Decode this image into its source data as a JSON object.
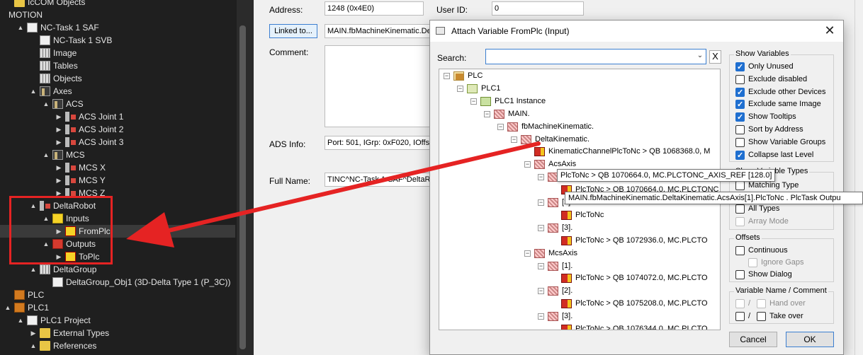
{
  "tree": {
    "items": [
      {
        "label": "IcCOM Objects",
        "indent": 0,
        "icon": "folder",
        "expander": ""
      },
      {
        "label": "MOTION",
        "indent": 0,
        "icon": "none",
        "expander": ""
      },
      {
        "label": "NC-Task 1 SAF",
        "indent": 1,
        "icon": "page",
        "expander": "▲"
      },
      {
        "label": "NC-Task 1 SVB",
        "indent": 2,
        "icon": "page",
        "expander": ""
      },
      {
        "label": "Image",
        "indent": 2,
        "icon": "grid",
        "expander": ""
      },
      {
        "label": "Tables",
        "indent": 2,
        "icon": "grid",
        "expander": ""
      },
      {
        "label": "Objects",
        "indent": 2,
        "icon": "grid",
        "expander": ""
      },
      {
        "label": "Axes",
        "indent": 2,
        "icon": "axis",
        "expander": "▲"
      },
      {
        "label": "ACS",
        "indent": 3,
        "icon": "axis",
        "expander": "▲"
      },
      {
        "label": "ACS Joint 1",
        "indent": 4,
        "icon": "joint",
        "expander": "▶"
      },
      {
        "label": "ACS Joint 2",
        "indent": 4,
        "icon": "joint",
        "expander": "▶"
      },
      {
        "label": "ACS Joint 3",
        "indent": 4,
        "icon": "joint",
        "expander": "▶"
      },
      {
        "label": "MCS",
        "indent": 3,
        "icon": "axis",
        "expander": "▲"
      },
      {
        "label": "MCS X",
        "indent": 4,
        "icon": "joint",
        "expander": "▶"
      },
      {
        "label": "MCS Y",
        "indent": 4,
        "icon": "joint",
        "expander": "▶"
      },
      {
        "label": "MCS Z",
        "indent": 4,
        "icon": "joint",
        "expander": "▶"
      },
      {
        "label": "DeltaRobot",
        "indent": 2,
        "icon": "joint",
        "expander": "▲"
      },
      {
        "label": "Inputs",
        "indent": 3,
        "icon": "yellow",
        "expander": "▲"
      },
      {
        "label": "FromPlc",
        "indent": 4,
        "icon": "var",
        "expander": "▶",
        "selected": true
      },
      {
        "label": "Outputs",
        "indent": 3,
        "icon": "red",
        "expander": "▲"
      },
      {
        "label": "ToPlc",
        "indent": 4,
        "icon": "var",
        "expander": "▶"
      },
      {
        "label": "DeltaGroup",
        "indent": 2,
        "icon": "grid",
        "expander": "▲"
      },
      {
        "label": "DeltaGroup_Obj1 (3D-Delta Type 1 (P_3C))",
        "indent": 3,
        "icon": "page",
        "expander": ""
      },
      {
        "label": "PLC",
        "indent": 0,
        "icon": "plc",
        "expander": ""
      },
      {
        "label": "PLC1",
        "indent": 0,
        "icon": "plc",
        "expander": "▲"
      },
      {
        "label": "PLC1 Project",
        "indent": 1,
        "icon": "page",
        "expander": "▲"
      },
      {
        "label": "External Types",
        "indent": 2,
        "icon": "folder",
        "expander": "▶"
      },
      {
        "label": "References",
        "indent": 2,
        "icon": "folder",
        "expander": "▲"
      }
    ]
  },
  "form": {
    "address_label": "Address:",
    "address_value": "1248 (0x4E0)",
    "userid_label": "User ID:",
    "userid_value": "0",
    "linked_button": "Linked to...",
    "linked_value": "MAIN.fbMachineKinematic.De",
    "comment_label": "Comment:",
    "ads_label": "ADS Info:",
    "ads_value": "Port: 501, IGrp: 0xF020, IOffs:",
    "fullname_label": "Full Name:",
    "fullname_value": "TINC^NC-Task 1 SAF^DeltaR"
  },
  "dialog": {
    "title": "Attach Variable FromPlc (Input)",
    "close": "✕",
    "search_label": "Search:",
    "search_value": "",
    "search_clear": "X",
    "var_tree": [
      {
        "label": "PLC",
        "indent": 0,
        "icon": "plc",
        "exp": "−"
      },
      {
        "label": "PLC1",
        "indent": 1,
        "icon": "plc1",
        "exp": "−"
      },
      {
        "label": "PLC1 Instance",
        "indent": 2,
        "icon": "inst",
        "exp": "−"
      },
      {
        "label": "MAIN.",
        "indent": 3,
        "icon": "struct",
        "exp": "−"
      },
      {
        "label": "fbMachineKinematic.",
        "indent": 4,
        "icon": "struct",
        "exp": "−"
      },
      {
        "label": "DeltaKinematic.",
        "indent": 5,
        "icon": "struct",
        "exp": "−"
      },
      {
        "label": "KinematicChannelPlcToNc   >   QB 1068368.0, M",
        "indent": 6,
        "icon": "varin",
        "exp": ""
      },
      {
        "label": "AcsAxis",
        "indent": 6,
        "icon": "struct",
        "exp": "−"
      },
      {
        "label": "[1].",
        "indent": 7,
        "icon": "struct",
        "exp": "−"
      },
      {
        "label": "PlcToNc   >   QB 1070664.0, MC.PLCTONC_AXIS_REF [128.0]",
        "indent": 8,
        "icon": "varin",
        "exp": ""
      },
      {
        "label": "[2].",
        "indent": 7,
        "icon": "struct",
        "exp": "−"
      },
      {
        "label": "PlcToNc",
        "indent": 8,
        "icon": "varin",
        "exp": ""
      },
      {
        "label": "[3].",
        "indent": 7,
        "icon": "struct",
        "exp": "−"
      },
      {
        "label": "PlcToNc   >   QB 1072936.0, MC.PLCTO",
        "indent": 8,
        "icon": "varin",
        "exp": ""
      },
      {
        "label": "McsAxis",
        "indent": 6,
        "icon": "struct",
        "exp": "−"
      },
      {
        "label": "[1].",
        "indent": 7,
        "icon": "struct",
        "exp": "−"
      },
      {
        "label": "PlcToNc   >   QB 1074072.0, MC.PLCTO",
        "indent": 8,
        "icon": "varin",
        "exp": ""
      },
      {
        "label": "[2].",
        "indent": 7,
        "icon": "struct",
        "exp": "−"
      },
      {
        "label": "PlcToNc   >   QB 1075208.0, MC.PLCTO",
        "indent": 8,
        "icon": "varin",
        "exp": ""
      },
      {
        "label": "[3].",
        "indent": 7,
        "icon": "struct",
        "exp": "−"
      },
      {
        "label": "PlcToNc   >   QB 1076344.0, MC.PLCTO",
        "indent": 8,
        "icon": "varin",
        "exp": ""
      }
    ],
    "tooltip_short": "PlcToNc   >   QB 1070664.0, MC.PLCTONC_AXIS_REF [128.0]",
    "tooltip_long": "MAIN.fbMachineKinematic.DeltaKinematic.AcsAxis[1].PlcToNc . PlcTask Outpu",
    "show_variables": {
      "title": "Show Variables",
      "options": [
        {
          "label": "Only Unused",
          "checked": true
        },
        {
          "label": "Exclude disabled",
          "checked": false
        },
        {
          "label": "Exclude other Devices",
          "checked": true
        },
        {
          "label": "Exclude same Image",
          "checked": true
        },
        {
          "label": "Show Tooltips",
          "checked": true
        },
        {
          "label": "Sort by Address",
          "checked": false
        },
        {
          "label": "Show Variable Groups",
          "checked": false
        },
        {
          "label": "Collapse last Level",
          "checked": true
        }
      ]
    },
    "show_variable_types": {
      "title": "Show Variable Types",
      "matching_type": "Matching Type",
      "all_types": "All Types",
      "array_mode": "Array Mode"
    },
    "offsets": {
      "title": "Offsets",
      "continuous": "Continuous",
      "ignore_gaps": "Ignore Gaps",
      "show_dialog": "Show Dialog"
    },
    "varname": {
      "title": "Variable Name / Comment",
      "hand_over": "Hand over",
      "take_over": "Take over",
      "sep": "/"
    },
    "cancel": "Cancel",
    "ok": "OK"
  },
  "colors": {
    "annotation_red": "#e52323",
    "accent": "#1f6fd0"
  }
}
